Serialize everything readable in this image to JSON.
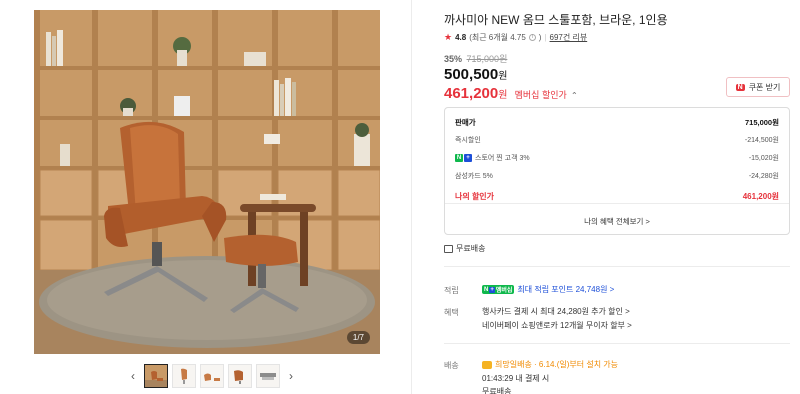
{
  "gallery": {
    "counter": "1/7",
    "prev_icon": "chevron-left-icon",
    "next_icon": "chevron-right-icon",
    "thumb_count": 5
  },
  "product": {
    "title": "까사미아 NEW 옴므 스툴포함, 브라운, 1인용",
    "rating": {
      "star_icon": "star-icon",
      "score": "4.8",
      "detail": "(최근 6개월 4.75",
      "reviews": "697건 리뷰"
    },
    "discount_rate": "35%",
    "original_price": "715,000원",
    "price": "500,500",
    "price_unit": "원",
    "member_price": "461,200",
    "member_unit": "원",
    "member_desc": "멤버십 할인가",
    "coupon_label": "쿠폰 받기",
    "coupon_badge": "N"
  },
  "price_box": {
    "rows": [
      {
        "label": "판매가",
        "value": "715,000원"
      },
      {
        "label": "즉시할인",
        "value": "-214,500원"
      },
      {
        "label": "스토어 찐 고객 3%",
        "value": "-15,020원"
      },
      {
        "label": "삼성카드 5%",
        "value": "-24,280원"
      },
      {
        "label": "나의 할인가",
        "value": "461,200원"
      }
    ],
    "benefit_link": "나의 혜택 전체보기 >"
  },
  "shipping_free": "무료배송",
  "fields": {
    "points_label": "적립",
    "points_value": "최대 적립 포인트 24,748원 >",
    "benefits_label": "혜택",
    "benefit_line1": "행사카드 결제 시 최대 24,280원 추가 할인 >",
    "benefit_line2": "네이버페이 쇼핑앤로카 12개월 무이자 할부 >",
    "delivery_label": "배송",
    "delivery_line1": "희망일배송 · 6.14.(일)부터 설치 가능",
    "delivery_line2": "01:43:29  내 결제 시",
    "delivery_line3": "무료배송"
  },
  "colors": {
    "accent_red": "#e6323b",
    "naver_green": "#0fb84c",
    "link_blue": "#1d4fd8"
  }
}
